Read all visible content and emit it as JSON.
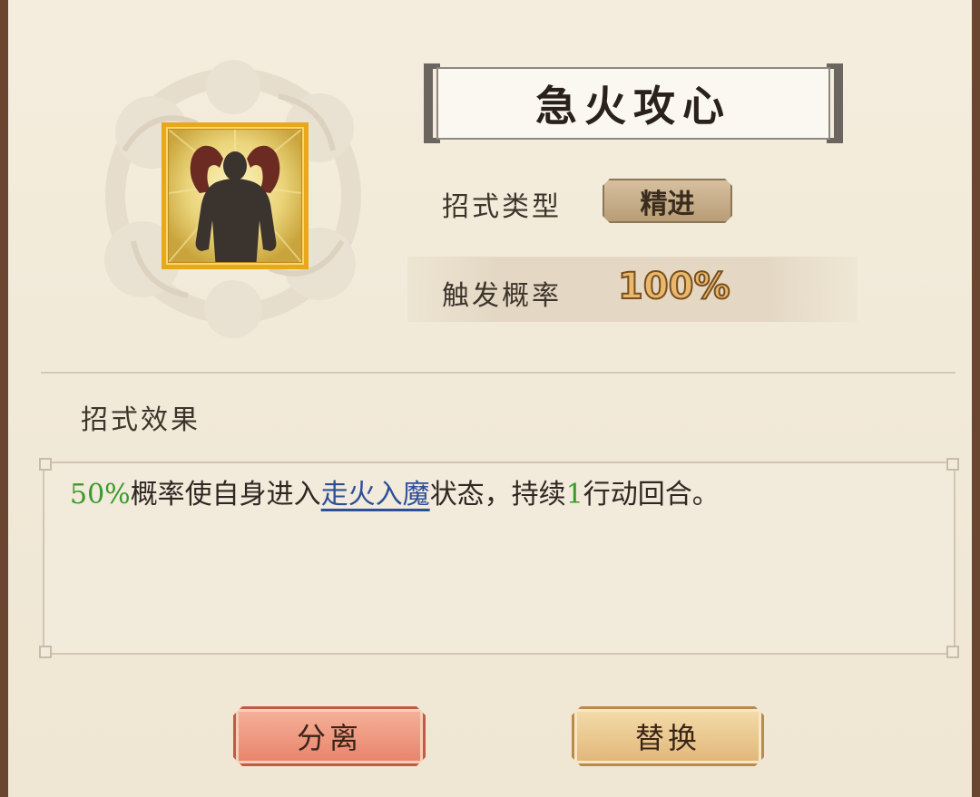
{
  "skill": {
    "name": "急火攻心",
    "icon": "flexing-silhouette-icon",
    "type_label": "招式类型",
    "type_value": "精进",
    "prob_label": "触发概率",
    "prob_value": "100%"
  },
  "effect": {
    "header": "招式效果",
    "parts": {
      "p1": "50%",
      "p2": "概率使自身进入",
      "p3": "走火入魔",
      "p4": "状态，持续",
      "p5": "1",
      "p6": "行动回合。"
    }
  },
  "buttons": {
    "split": "分离",
    "replace": "替换"
  },
  "colors": {
    "frame": "#6a4630",
    "parchment": "#f1e9d8",
    "highlight_green": "#3a9a2c",
    "link_blue": "#2d4f9a",
    "icon_border": "#e8a81a"
  }
}
